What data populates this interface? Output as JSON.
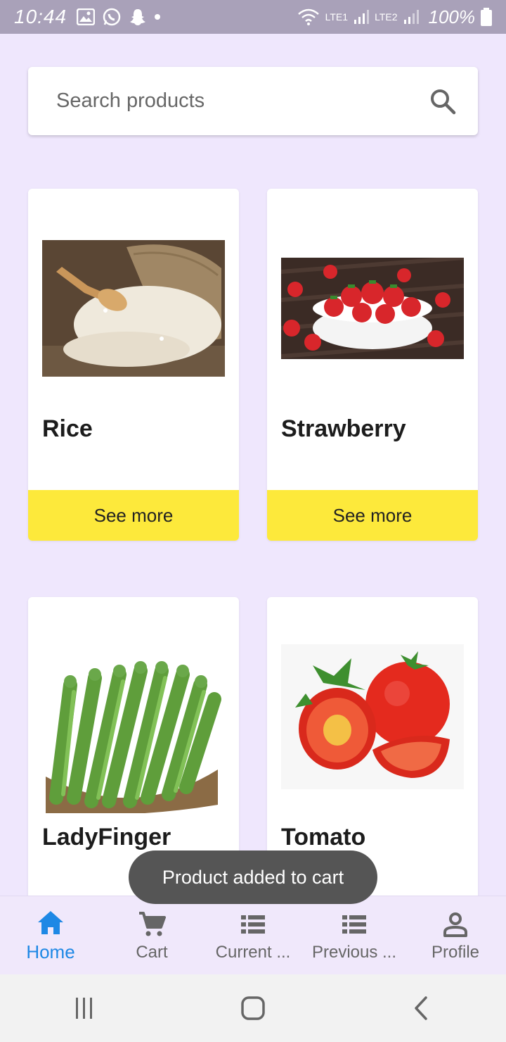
{
  "status_bar": {
    "time": "10:44",
    "battery": "100%",
    "sim1_label": "LTE1",
    "sim2_label": "LTE2"
  },
  "search": {
    "placeholder": "Search products"
  },
  "products": [
    {
      "name": "Rice",
      "button": "See more"
    },
    {
      "name": "Strawberry",
      "button": "See more"
    },
    {
      "name": "LadyFinger"
    },
    {
      "name": "Tomato"
    }
  ],
  "toast": "Product added to cart",
  "bottom_nav": [
    {
      "label": "Home",
      "icon": "home-icon",
      "active": true
    },
    {
      "label": "Cart",
      "icon": "cart-icon"
    },
    {
      "label": "Current ...",
      "icon": "list-icon"
    },
    {
      "label": "Previous ...",
      "icon": "list-icon"
    },
    {
      "label": "Profile",
      "icon": "person-icon"
    }
  ],
  "colors": {
    "background": "#efe7fd",
    "accent": "#1e88e5",
    "button": "#fde93b"
  }
}
